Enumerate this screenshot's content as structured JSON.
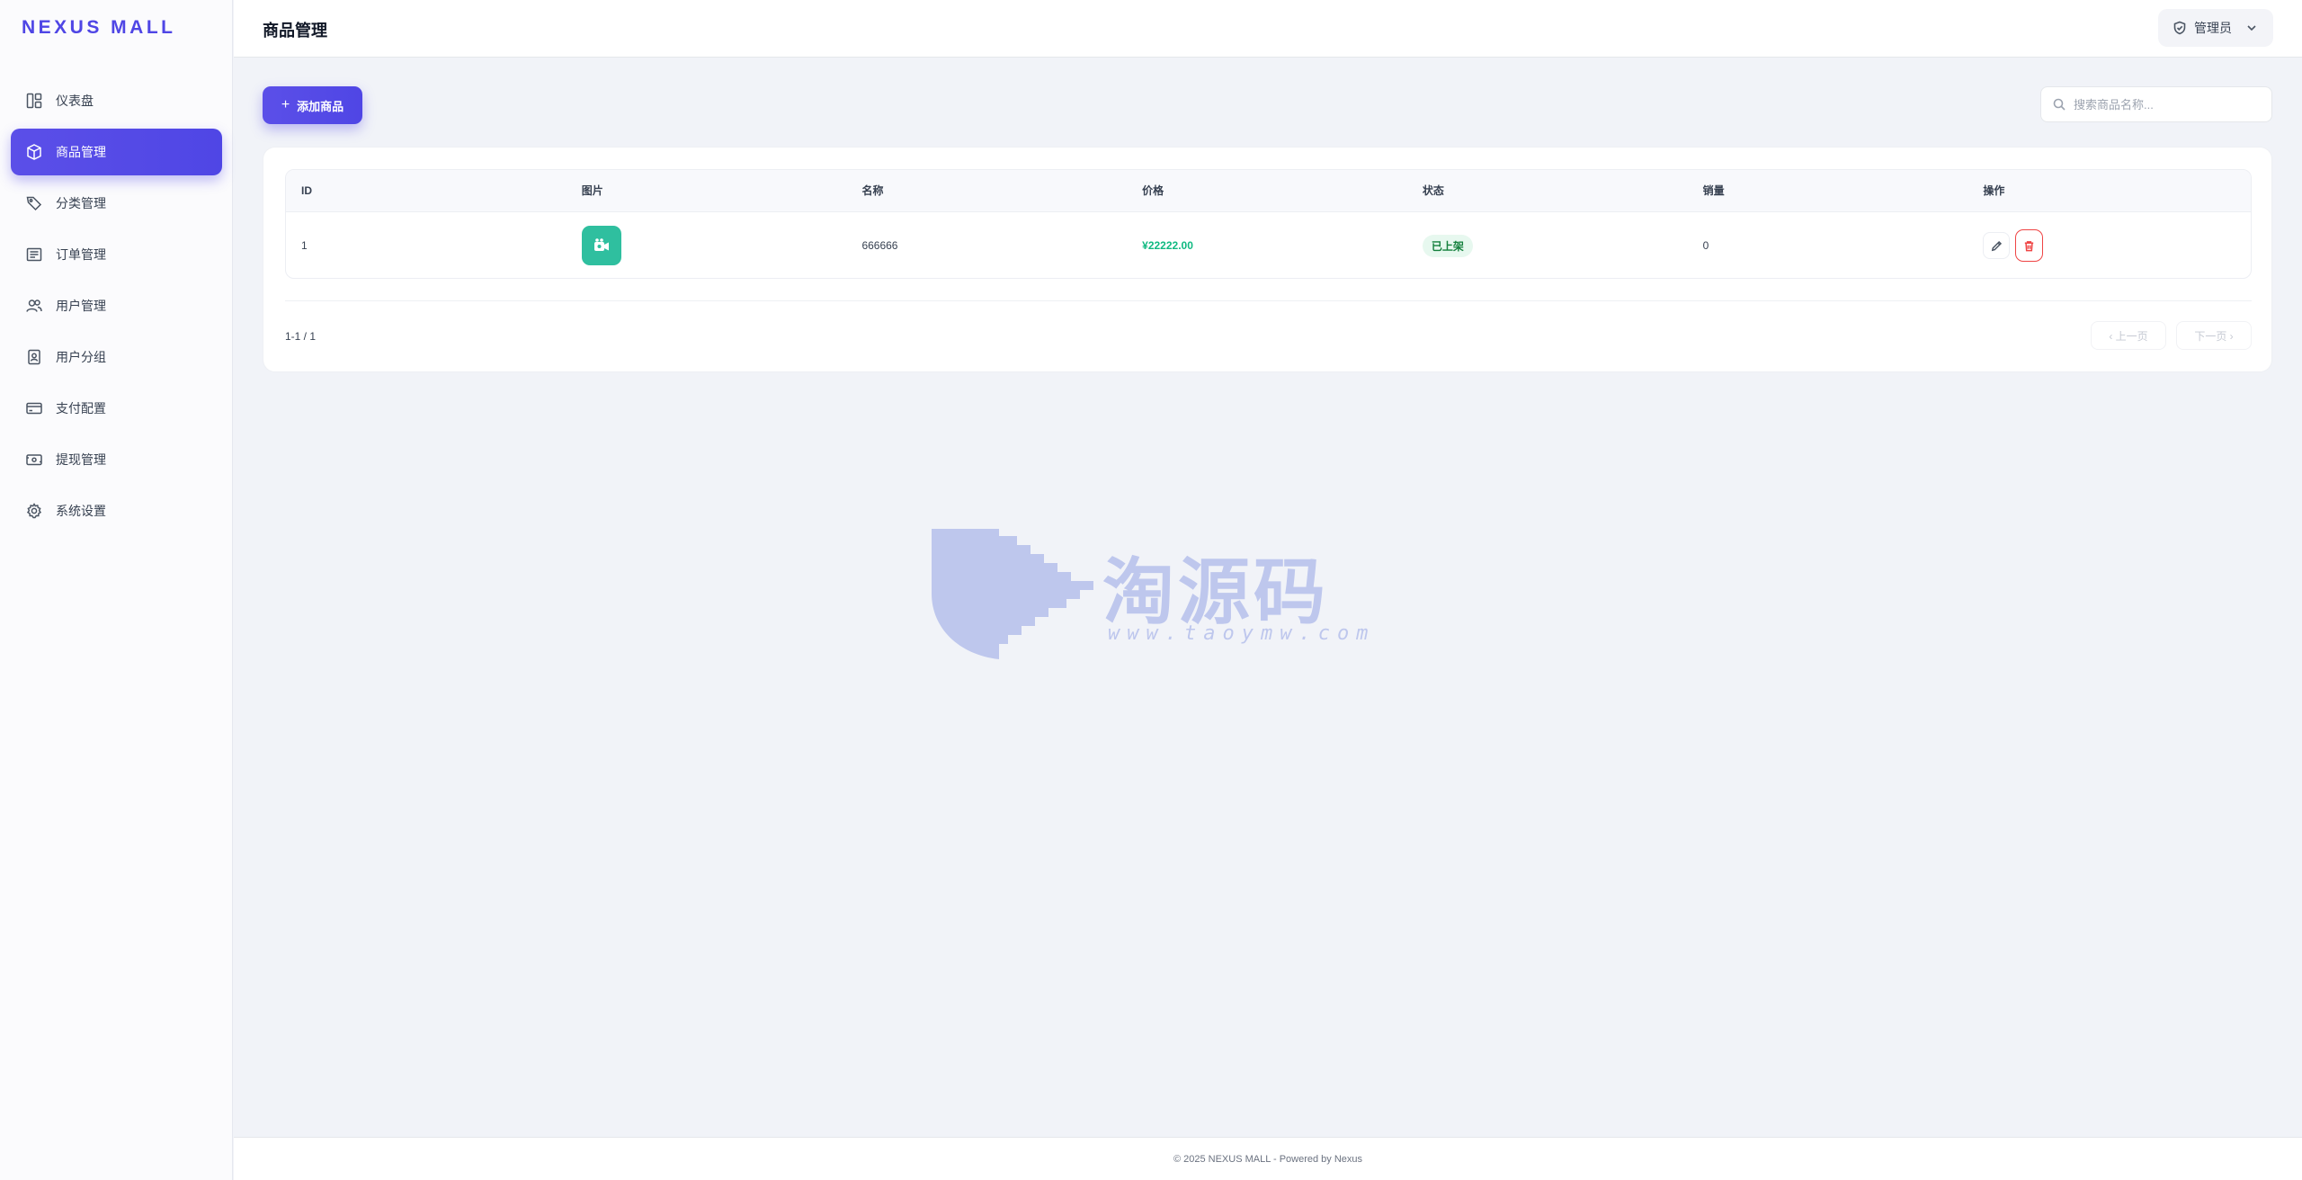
{
  "brand": "NEXUS MALL",
  "sidebar": {
    "items": [
      {
        "label": "仪表盘",
        "icon": "dashboard-icon",
        "active": false
      },
      {
        "label": "商品管理",
        "icon": "box-icon",
        "active": true
      },
      {
        "label": "分类管理",
        "icon": "tag-icon",
        "active": false
      },
      {
        "label": "订单管理",
        "icon": "order-icon",
        "active": false
      },
      {
        "label": "用户管理",
        "icon": "users-icon",
        "active": false
      },
      {
        "label": "用户分组",
        "icon": "user-badge-icon",
        "active": false
      },
      {
        "label": "支付配置",
        "icon": "credit-card-icon",
        "active": false
      },
      {
        "label": "提现管理",
        "icon": "withdraw-icon",
        "active": false
      },
      {
        "label": "系统设置",
        "icon": "gear-icon",
        "active": false
      }
    ]
  },
  "header": {
    "title": "商品管理",
    "user_label": "管理员"
  },
  "toolbar": {
    "add_label": "添加商品",
    "search_placeholder": "搜索商品名称..."
  },
  "table": {
    "columns": [
      "ID",
      "图片",
      "名称",
      "价格",
      "状态",
      "销量",
      "操作"
    ],
    "rows": [
      {
        "id": "1",
        "name": "666666",
        "price": "¥22222.00",
        "status": "已上架",
        "sales": "0"
      }
    ]
  },
  "pagination": {
    "info": "1-1 / 1",
    "prev_label": "‹ 上一页",
    "next_label": "下一页 ›"
  },
  "footer": {
    "text": "© 2025 NEXUS MALL - Powered by Nexus"
  },
  "watermark": {
    "text": "淘源码",
    "url": "www.taoymw.com"
  },
  "colors": {
    "accent": "#4f46e5",
    "success": "#10b981",
    "danger": "#ef4444",
    "thumb": "#2fbf9f"
  }
}
